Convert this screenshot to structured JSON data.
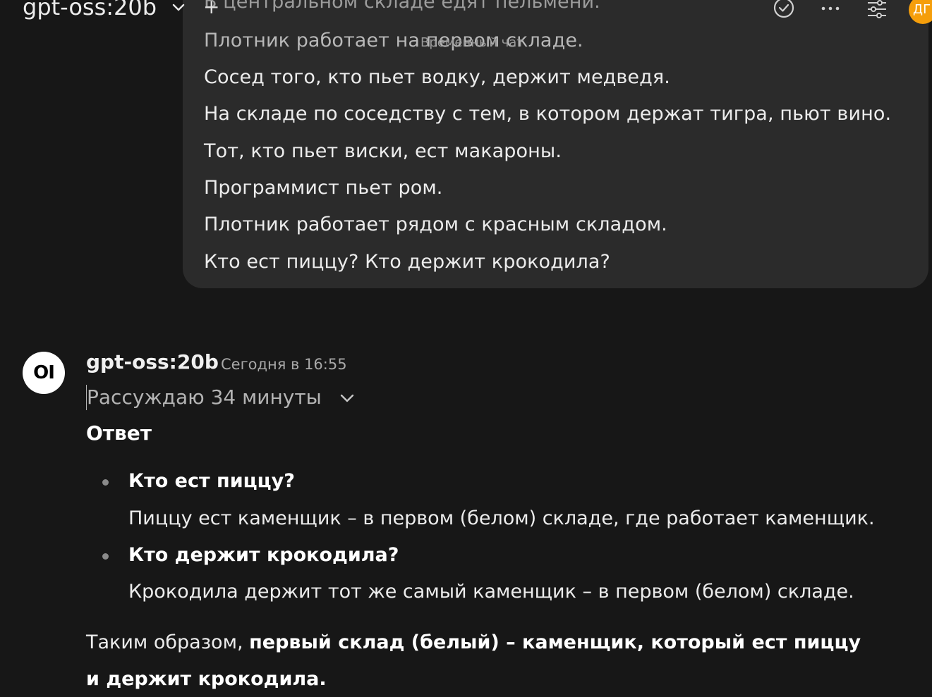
{
  "header": {
    "model_name": "gpt-oss:20b",
    "new_chat_symbol": "+",
    "temporary_chat_label": "Временный чат",
    "user_initials": "ДГ"
  },
  "user_message": {
    "lines": [
      "В центральном складе едят пельмени.",
      "Плотник работает на первом складе.",
      "Сосед того, кто пьет водку, держит медведя.",
      "На складе по соседству с тем, в котором держат тигра, пьют вино.",
      "Тот, кто пьет виски, ест макароны.",
      "Программист пьет ром.",
      "Плотник работает рядом с красным складом.",
      "Кто ест пиццу? Кто держит крокодила?"
    ]
  },
  "assistant": {
    "logo_text": "OI",
    "model_name": "gpt-oss:20b",
    "timestamp": "Сегодня в 16:55",
    "thinking_label": "Рассуждаю 34 минуты",
    "answer_heading": "Ответ",
    "items": [
      {
        "question": "Кто ест пиццу?",
        "answer": "Пиццу ест каменщик – в первом (белом) складе, где работает каменщик."
      },
      {
        "question": "Кто держит крокодила?",
        "answer": "Крокодила держит тот же самый каменщик – в первом (белом) складе."
      }
    ],
    "conclusion_prefix": "Таким образом,",
    "conclusion_bold": "первый склад (белый) – каменщик, который ест пиццу и держит крокодила."
  },
  "colors": {
    "background": "#171717",
    "bubble": "#2b2b2b",
    "avatar": "#f59e0b"
  }
}
